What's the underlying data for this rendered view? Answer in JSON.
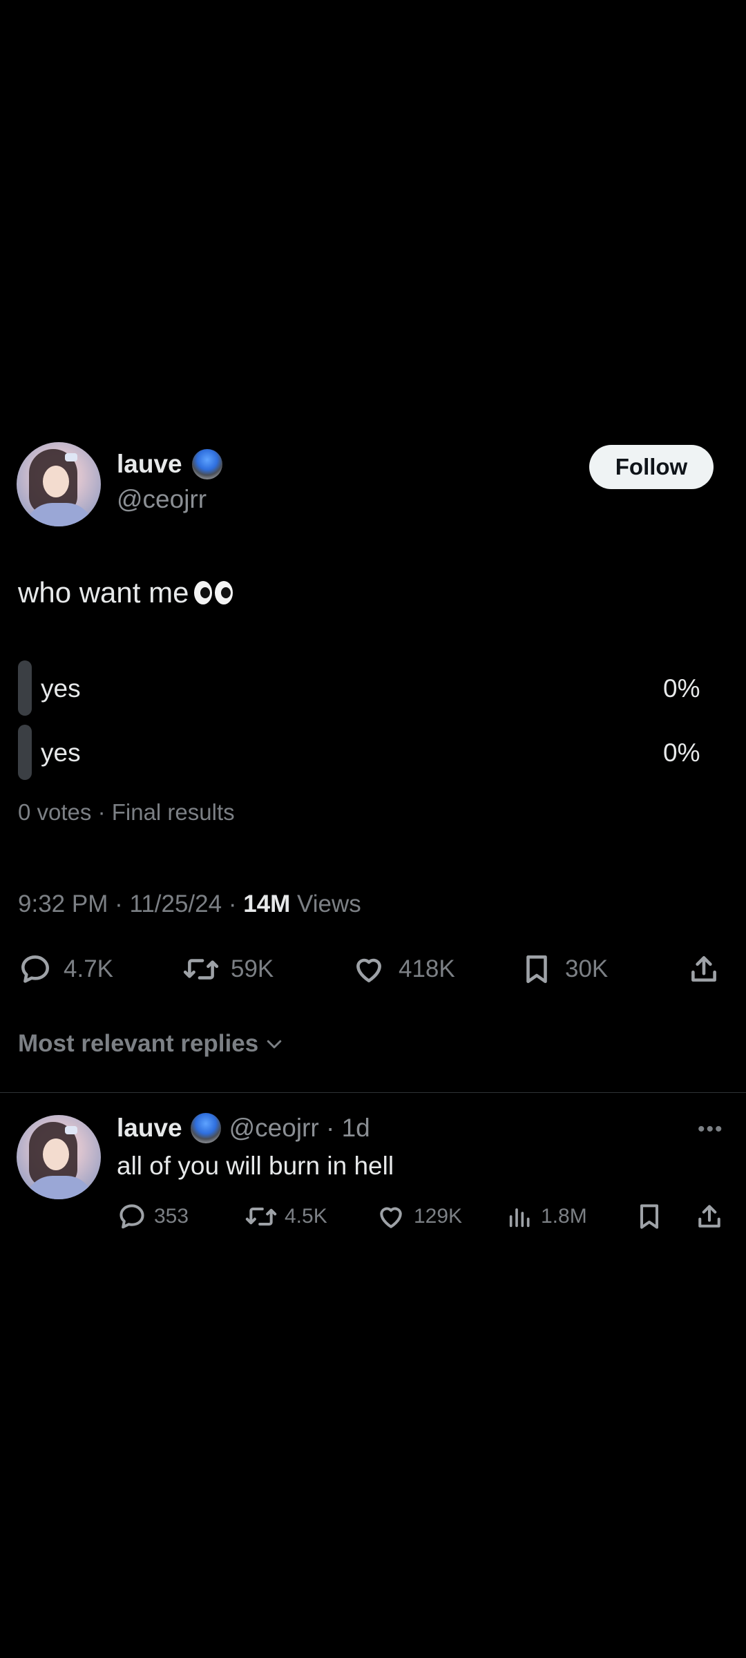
{
  "tweet": {
    "display_name": "lauve",
    "handle": "@ceojrr",
    "follow_label": "Follow",
    "text": "who want me",
    "emoji_icon": "eyes-emoji",
    "poll": {
      "options": [
        {
          "label": "yes",
          "percent": "0%"
        },
        {
          "label": "yes",
          "percent": "0%"
        }
      ],
      "summary": "0 votes · Final results"
    },
    "timestamp": "9:32 PM · 11/25/24 · ",
    "views_count": "14M",
    "views_label": " Views",
    "actions": {
      "replies": "4.7K",
      "reposts": "59K",
      "likes": "418K",
      "bookmarks": "30K"
    },
    "sort_label": "Most relevant replies"
  },
  "reply": {
    "display_name": "lauve",
    "handle_time": "@ceojrr · 1d",
    "text": "all of you will burn in hell",
    "more_label": "•••",
    "actions": {
      "replies": "353",
      "reposts": "4.5K",
      "likes": "129K",
      "views": "1.8M"
    }
  },
  "colors": {
    "background": "#000000",
    "text_primary": "#e7e9ea",
    "text_muted": "#7c8085",
    "follow_bg": "#eff3f4"
  }
}
